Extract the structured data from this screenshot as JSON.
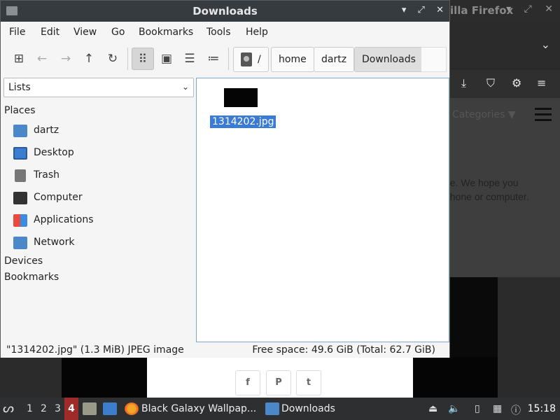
{
  "firefox": {
    "title": "illa Firefox",
    "categories_label": "Categories ▼",
    "text_line1": "ee. We hope you",
    "text_line2": "phone or computer.",
    "share_facebook": "f",
    "share_pinterest": "P",
    "share_twitter": "t"
  },
  "window": {
    "title": "Downloads"
  },
  "menubar": [
    "File",
    "Edit",
    "View",
    "Go",
    "Bookmarks",
    "Tools",
    "Help"
  ],
  "breadcrumb": {
    "root": "/",
    "items": [
      "home",
      "dartz",
      "Downloads"
    ]
  },
  "sidebar": {
    "dropdown_value": "Lists",
    "places_label": "Places",
    "places": [
      "dartz",
      "Desktop",
      "Trash",
      "Computer",
      "Applications",
      "Network"
    ],
    "devices_label": "Devices",
    "bookmarks_label": "Bookmarks"
  },
  "files": [
    {
      "name": "1314202.jpg",
      "selected": true
    }
  ],
  "status": {
    "left": "\"1314202.jpg\" (1.3 MiB) JPEG image",
    "right": "Free space: 49.6 GiB (Total: 62.7 GiB)"
  },
  "taskbar": {
    "workspaces": [
      "1",
      "2",
      "3",
      "4"
    ],
    "active_workspace": "4",
    "tasks": [
      "Black Galaxy Wallpap...",
      "Downloads"
    ],
    "clock": "15:18"
  },
  "colors": {
    "selection": "#3a7bd5",
    "titlebar": "#363b40",
    "active_workspace": "#9e2a2a"
  }
}
